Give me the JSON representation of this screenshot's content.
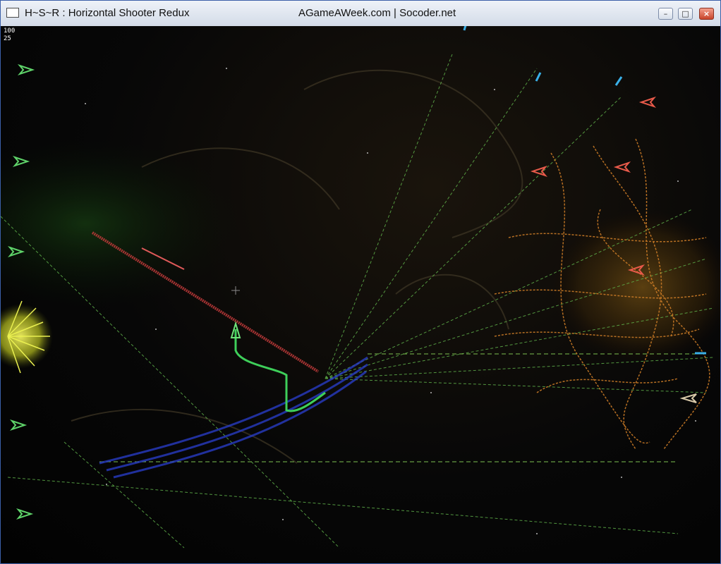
{
  "window": {
    "title": "H~S~R : Horizontal Shooter Redux",
    "subtitle": "AGameAWeek.com | Socoder.net",
    "buttons": {
      "minimize": "–",
      "maximize": "□",
      "close": "×"
    }
  },
  "hud": {
    "health": "100",
    "score": "25"
  },
  "colors": {
    "enemy_green": "#6fd36a",
    "enemy_red": "#e85a4a",
    "laser_blue": "#3ab0e8",
    "sun_yellow": "#d8e030",
    "explosion_orange": "#d28a2a",
    "player_trail": "#2a3fd0"
  }
}
